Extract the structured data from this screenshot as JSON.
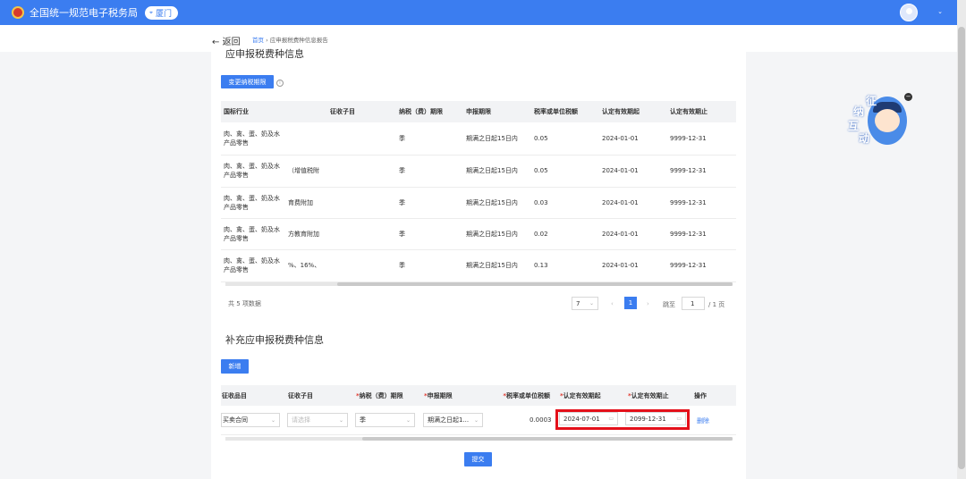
{
  "header": {
    "site_title": "全国统一规范电子税务局",
    "city": "厦门",
    "avatar_icon": "user-avatar-icon",
    "dropdown_icon": "chevron-down-icon"
  },
  "nav": {
    "back_label": "返回",
    "breadcrumb_home": "首页",
    "breadcrumb_sep": "›",
    "breadcrumb_current": "应申报税费种信息报告"
  },
  "section1": {
    "title": "应申报税费种信息",
    "change_button": "变更纳税期限",
    "columns": [
      "国标行业",
      "征收子目",
      "纳税（费）期限",
      "申报期限",
      "税率或单位税额",
      "认定有效期起",
      "认定有效期止"
    ],
    "rows": [
      {
        "industry": "肉、禽、蛋、奶及水产品零售",
        "sub_item": "",
        "period": "季",
        "deadline": "期满之日起15日内",
        "rate": "0.05",
        "start": "2024-01-01",
        "end": "9999-12-31"
      },
      {
        "industry": "肉、禽、蛋、奶及水产品零售",
        "sub_item": "（增值税附",
        "period": "季",
        "deadline": "期满之日起15日内",
        "rate": "0.05",
        "start": "2024-01-01",
        "end": "9999-12-31"
      },
      {
        "industry": "肉、禽、蛋、奶及水产品零售",
        "sub_item": "育费附加",
        "period": "季",
        "deadline": "期满之日起15日内",
        "rate": "0.03",
        "start": "2024-01-01",
        "end": "9999-12-31"
      },
      {
        "industry": "肉、禽、蛋、奶及水产品零售",
        "sub_item": "方教育附加",
        "period": "季",
        "deadline": "期满之日起15日内",
        "rate": "0.02",
        "start": "2024-01-01",
        "end": "9999-12-31"
      },
      {
        "industry": "肉、禽、蛋、奶及水产品零售",
        "sub_item": "%、16%、",
        "period": "季",
        "deadline": "期满之日起15日内",
        "rate": "0.13",
        "start": "2024-01-01",
        "end": "9999-12-31"
      }
    ],
    "total_text": "共 5 项数据",
    "page_size": "7",
    "current_page": "1",
    "goto_label": "跳至",
    "goto_value": "1",
    "total_pages": "/ 1 页",
    "prev": "‹",
    "next": "›"
  },
  "section2": {
    "title": "补充应申报税费种信息",
    "add_button": "新增",
    "columns": {
      "item": "征收品目",
      "sub_item": "征收子目",
      "period": "纳税（费）期限",
      "deadline": "申报期限",
      "rate": "税率或单位税额",
      "start": "认定有效期起",
      "end": "认定有效期止",
      "action": "操作"
    },
    "required_mark": "*",
    "row": {
      "item": "买卖合同",
      "sub_item_placeholder": "请选择",
      "period": "季",
      "deadline": "期满之日起1...",
      "rate": "0.0003",
      "start": "2024-07-01",
      "end": "2099-12-31",
      "delete": "删除"
    },
    "submit_button": "提交"
  },
  "widget": {
    "chars": [
      "征",
      "纳",
      "互",
      "动"
    ],
    "close": "−"
  },
  "colors": {
    "primary": "#3b7df0",
    "highlight": "#e4101a",
    "required": "#e03a2f"
  }
}
